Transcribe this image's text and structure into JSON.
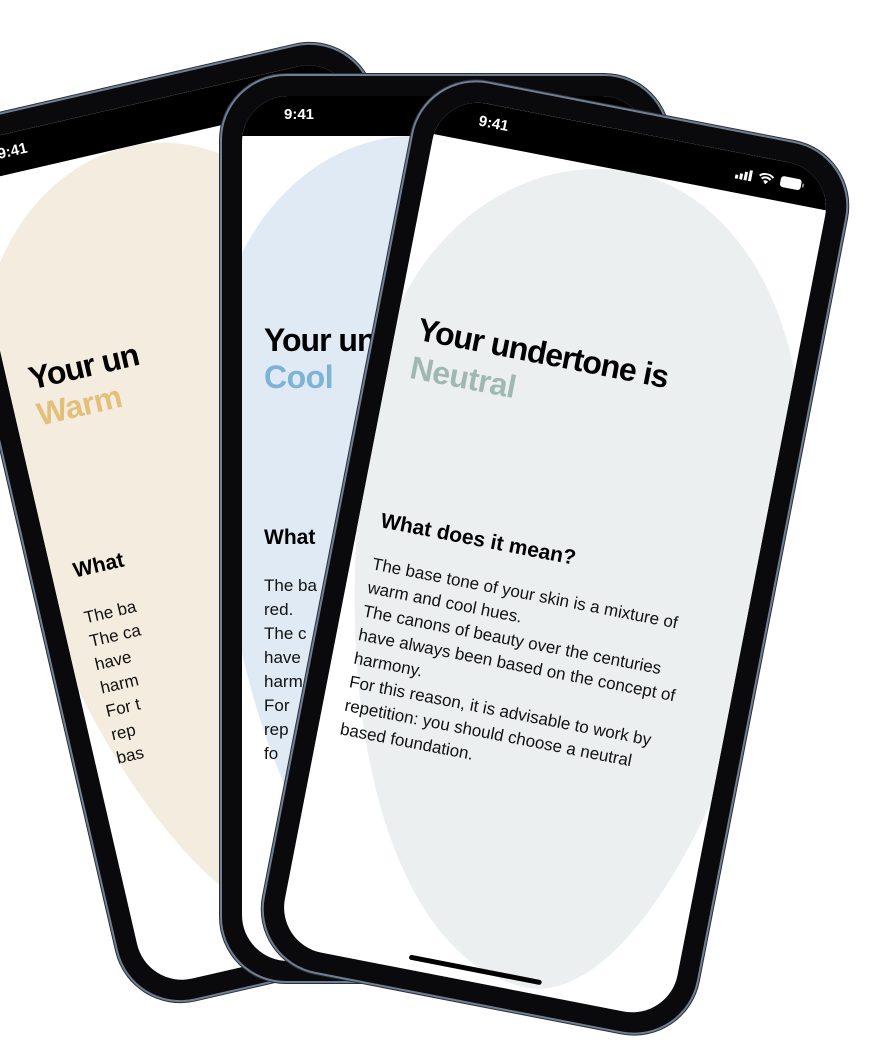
{
  "colors": {
    "warm": "#e3c07a",
    "warm_bg": "#f3ecdf",
    "cool": "#7fb3d5",
    "cool_bg": "#dfeaf5",
    "neutral": "#9fb8b0",
    "neutral_bg": "#ebefef"
  },
  "phones": {
    "warm": {
      "time": "9:41",
      "title": "Your un",
      "tone": "Warm",
      "heading": "What",
      "body": [
        "The ba",
        "The ca",
        "have",
        "harm",
        "For t",
        "rep",
        "bas"
      ]
    },
    "cool": {
      "time": "9:41",
      "title": "Your un",
      "tone": "Cool",
      "heading": "What",
      "body": [
        "The ba",
        "red.",
        "The c",
        "have",
        "harm",
        "For",
        "rep",
        "fo"
      ]
    },
    "neutral": {
      "time": "9:41",
      "title": "Your undertone is",
      "tone": "Neutral",
      "heading": "What does it mean?",
      "body": [
        "The base tone of your skin is a mixture of",
        "warm and cool hues.",
        "The canons of beauty over the centuries",
        "have always been based on the concept of",
        "harmony.",
        "For this reason, it is advisable to work by",
        "repetition: you should choose a neutral",
        "based foundation."
      ],
      "status_icons": [
        "signal-icon",
        "wifi-icon",
        "battery-icon"
      ]
    }
  }
}
